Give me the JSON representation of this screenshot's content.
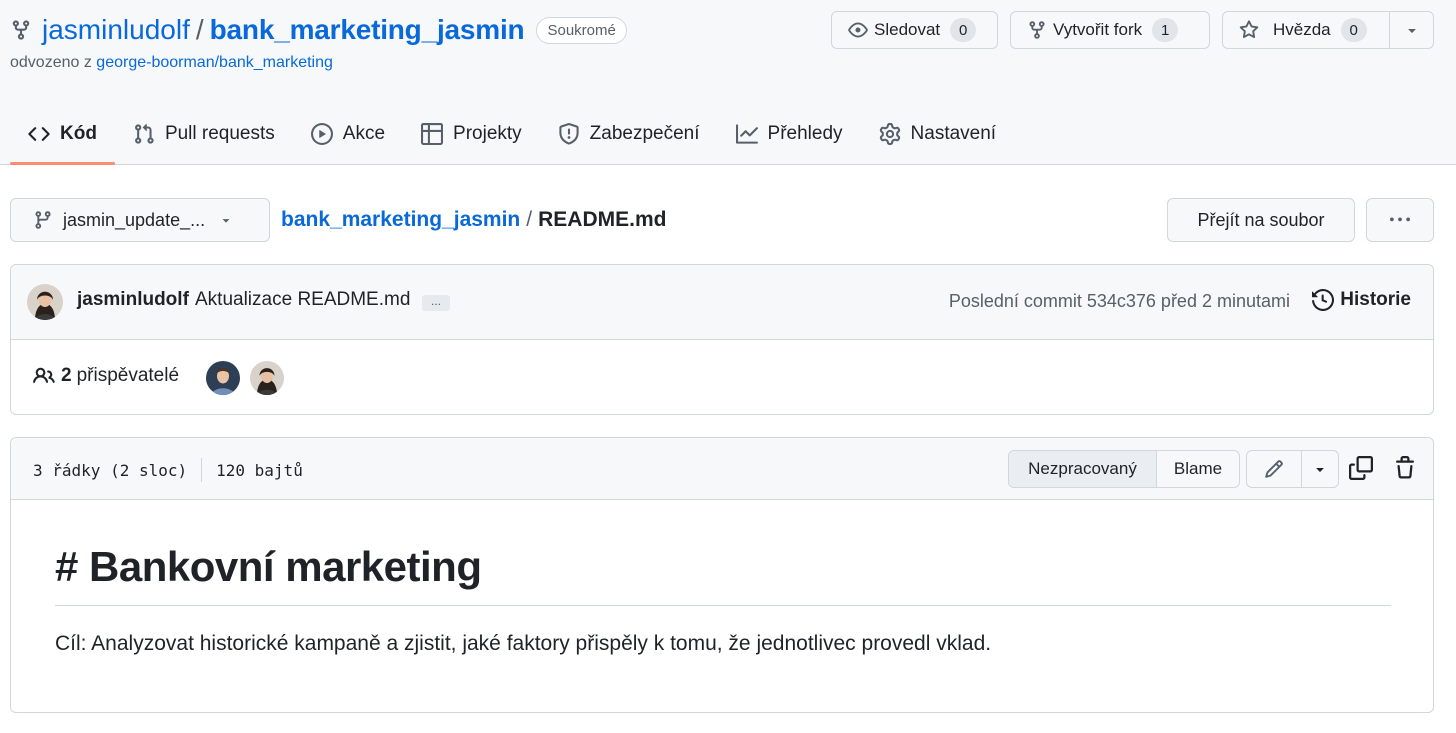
{
  "repo": {
    "owner": "jasminludolf",
    "separator": "/",
    "name": "bank_marketing_jasmin",
    "visibility": "Soukromé",
    "forked_prefix": "odvozeno z",
    "forked_from": "george-boorman/bank_marketing"
  },
  "header_buttons": {
    "watch": {
      "label": "Sledovat",
      "count": "0",
      "icon": "eye-icon"
    },
    "fork": {
      "label": "Vytvořit fork",
      "count": "1",
      "icon": "repo-forked-icon"
    },
    "star": {
      "label": "Hvězda",
      "count": "0",
      "icon": "star-icon"
    }
  },
  "tabs": [
    {
      "label": "Kód",
      "icon": "code-icon",
      "active": true
    },
    {
      "label": "Pull requests",
      "icon": "git-pull-request-icon"
    },
    {
      "label": "Akce",
      "icon": "play-icon"
    },
    {
      "label": "Projekty",
      "icon": "table-icon"
    },
    {
      "label": "Zabezpečení",
      "icon": "shield-icon"
    },
    {
      "label": "Přehledy",
      "icon": "graph-icon"
    },
    {
      "label": "Nastavení",
      "icon": "gear-icon"
    }
  ],
  "file_nav": {
    "branch": "jasmin_update_...",
    "breadcrumb_repo": "bank_marketing_jasmin",
    "breadcrumb_sep": "/",
    "file_name": "README.md",
    "goto_file": "Přejít na soubor"
  },
  "commit": {
    "author": "jasminludolf",
    "message": "Aktualizace README.md",
    "ellipsis": "...",
    "meta": "Poslední commit 534c376 před 2 minutami",
    "history": "Historie"
  },
  "contributors": {
    "count": "2",
    "label": "přispěvatelé"
  },
  "file": {
    "lines": "3 řádky (2 sloc)",
    "size": "120 bajtů",
    "raw_button": "Nezpracovaný",
    "blame_button": "Blame"
  },
  "readme": {
    "heading": "# Bankovní marketing",
    "paragraph": "Cíl: Analyzovat historické kampaně a zjistit, jaké faktory přispěly k tomu, že jednotlivec provedl vklad."
  },
  "colors": {
    "link": "#0969da",
    "active_tab_underline": "#fd8c73",
    "border": "#d0d7de",
    "header_bg": "#f6f8fa"
  }
}
